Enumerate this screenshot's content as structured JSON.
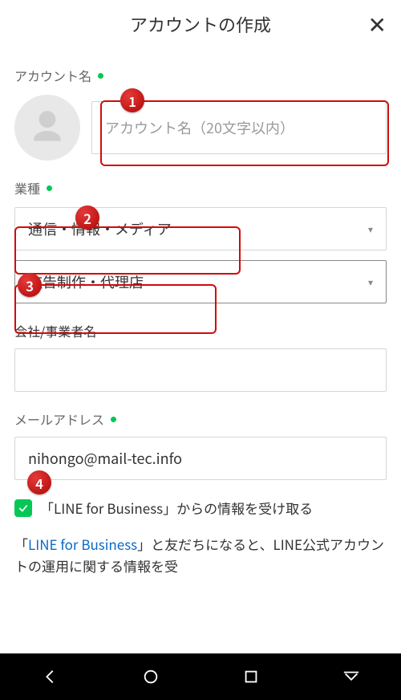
{
  "header": {
    "title": "アカウントの作成"
  },
  "account_name": {
    "label": "アカウント名",
    "placeholder": "アカウント名（20文字以内）"
  },
  "industry": {
    "label": "業種",
    "select1": "通信・情報・メディア",
    "select2": "広告制作・代理店"
  },
  "company": {
    "label": "会社/事業者名",
    "value": ""
  },
  "email": {
    "label": "メールアドレス",
    "value": "nihongo@mail-tec.info"
  },
  "consent": {
    "label": "「LINE for Business」からの情報を受け取る"
  },
  "info": {
    "prefix": "「",
    "link": "LINE for Business",
    "suffix": "」と友だちになると、LINE公式アカウントの運用に関する情報を受"
  },
  "callouts": {
    "b1": "1",
    "b2": "2",
    "b3": "3",
    "b4": "4"
  }
}
